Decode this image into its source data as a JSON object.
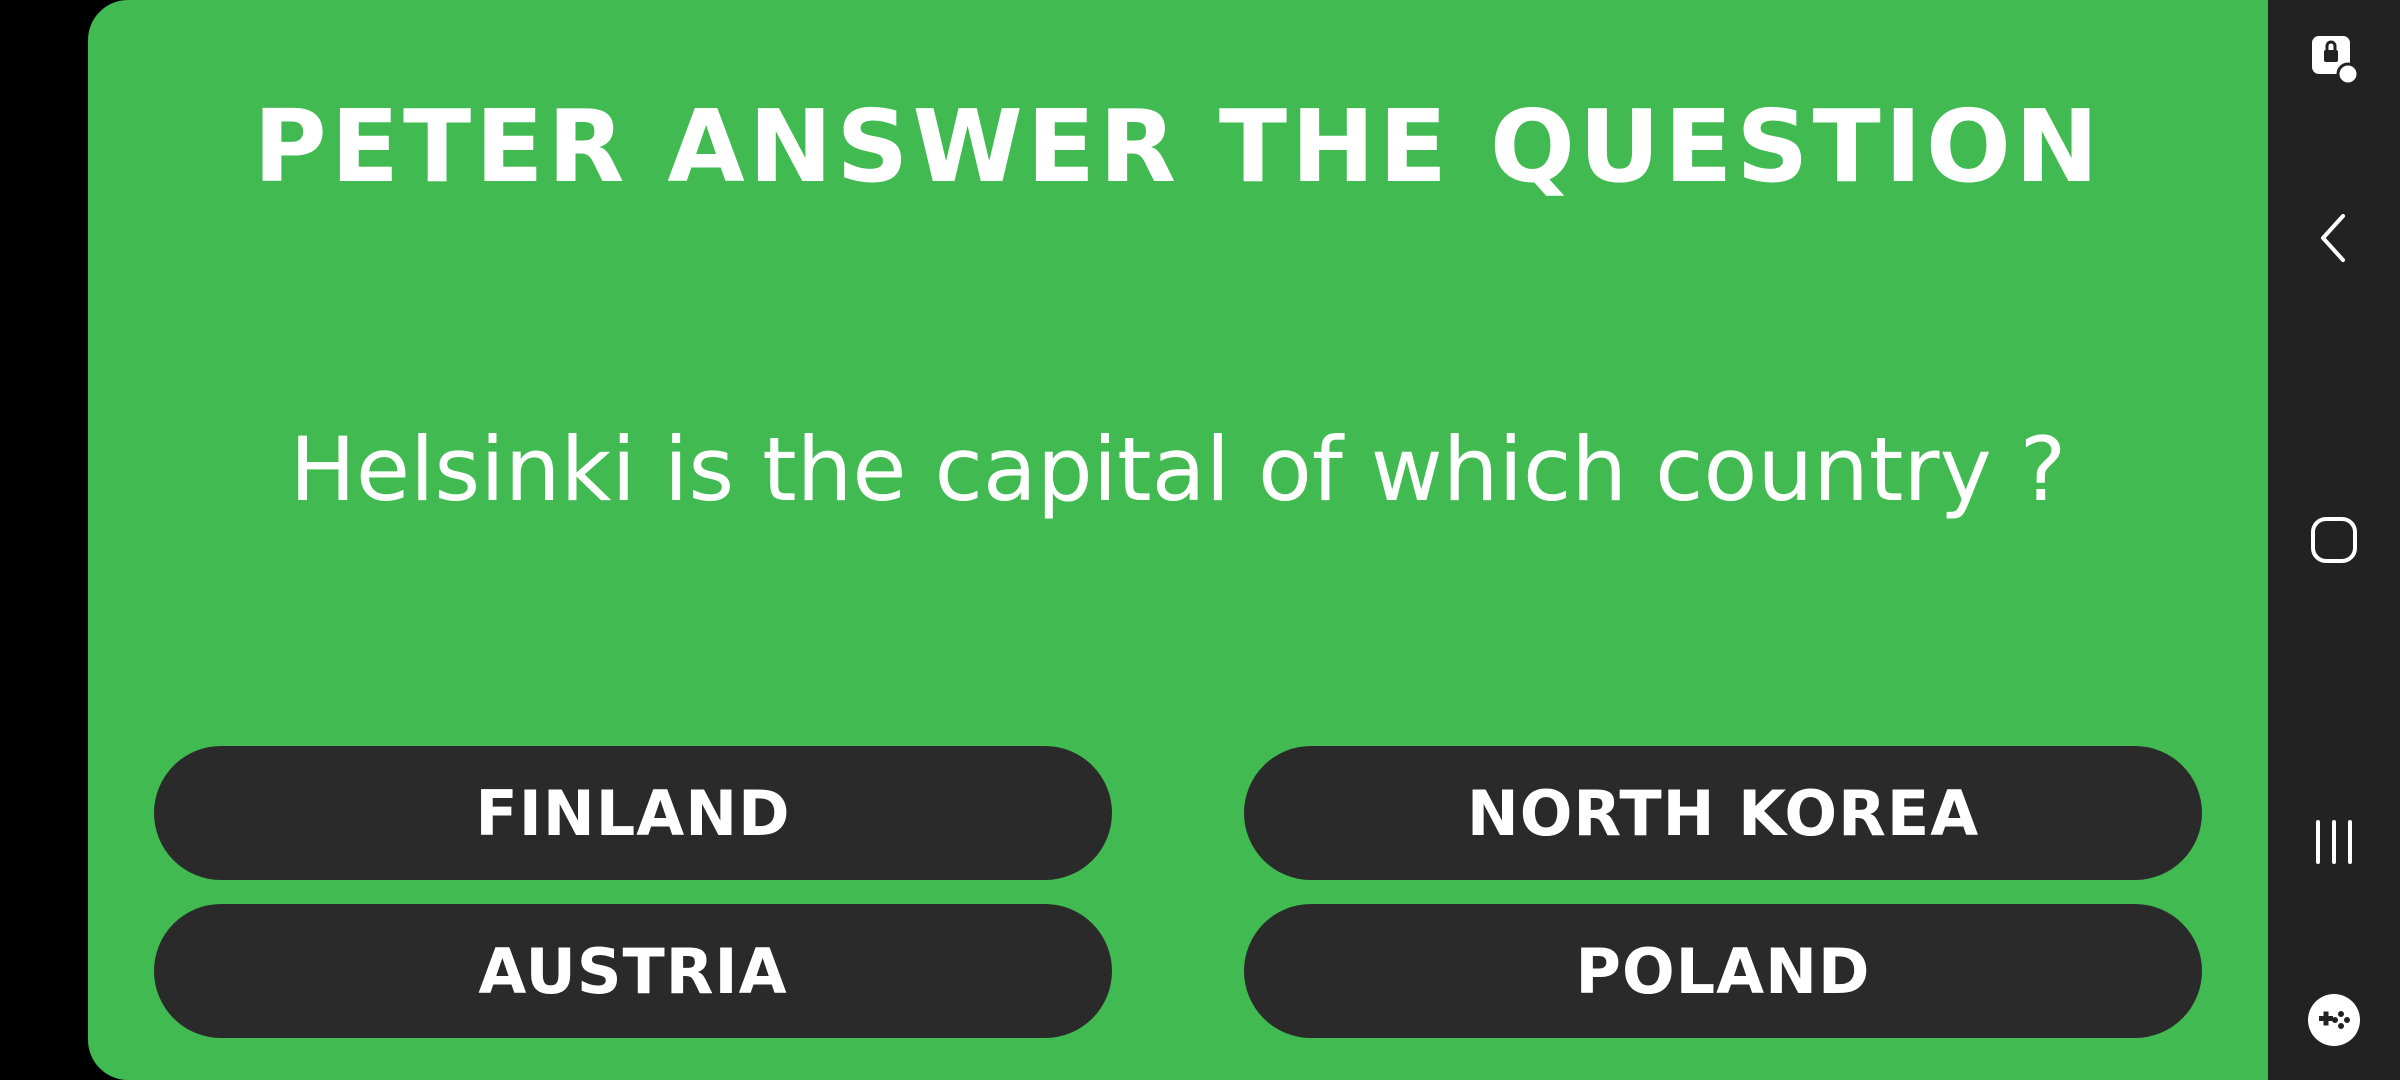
{
  "quiz": {
    "heading": "PETER ANSWER THE QUESTION",
    "question": "Helsinki is the capital of which country ?",
    "answers": [
      {
        "label": "FINLAND"
      },
      {
        "label": "NORTH KOREA"
      },
      {
        "label": "AUSTRIA"
      },
      {
        "label": "POLAND"
      }
    ]
  },
  "colors": {
    "panel_background": "#41bb51",
    "button_background": "#2a2a2a",
    "text": "#ffffff",
    "nav_bar_background": "#222222",
    "outer_background": "#000000"
  },
  "nav_bar": {
    "icons": [
      "screen-lock-icon",
      "back-icon",
      "home-icon",
      "recent-apps-icon",
      "game-tools-icon"
    ]
  }
}
